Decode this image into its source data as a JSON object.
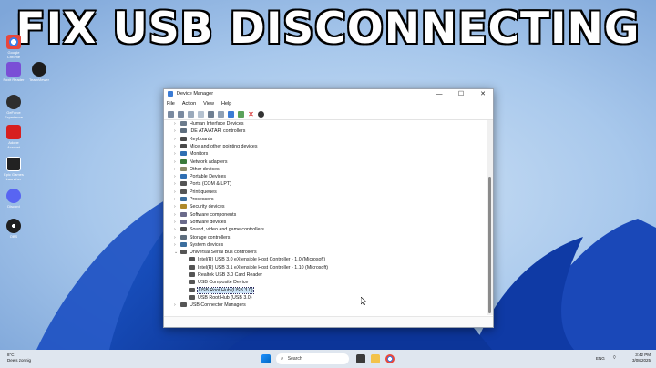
{
  "headline": "FIX USB DISCONNECTING",
  "desktop_icons": [
    {
      "label": "Google Chrome",
      "icon": "chrome-icon",
      "color": "#e8473c"
    },
    {
      "label": "Foxit Reader",
      "icon": "app-icon",
      "color": "#7a4fd6"
    },
    {
      "label": "GeForce Experience",
      "icon": "app-icon",
      "color": "#2e2e2e"
    },
    {
      "label": "Adobe Acrobat",
      "icon": "pdf-icon",
      "color": "#d71f1f"
    },
    {
      "label": "Epic Games Launcher",
      "icon": "epic-icon",
      "color": "#222222"
    },
    {
      "label": "Discord",
      "icon": "discord-icon",
      "color": "#5865f2"
    },
    {
      "label": "OBS",
      "icon": "obs-icon",
      "color": "#1f1f1f"
    },
    {
      "label": "TeamViewer",
      "icon": "chat-icon",
      "color": "#1d1d1d"
    }
  ],
  "window": {
    "title": "Device Manager",
    "controls": {
      "minimize": "—",
      "maximize": "☐",
      "close": "✕"
    },
    "menu": [
      "File",
      "Action",
      "View",
      "Help"
    ]
  },
  "tree": [
    {
      "label": "Human Interface Devices",
      "level": 1,
      "expander": "›",
      "color": "#6b7b8c"
    },
    {
      "label": "IDE ATA/ATAPI controllers",
      "level": 1,
      "expander": "›",
      "color": "#5e6e7e"
    },
    {
      "label": "Keyboards",
      "level": 1,
      "expander": "›",
      "color": "#4a4a4a"
    },
    {
      "label": "Mice and other pointing devices",
      "level": 1,
      "expander": "›",
      "color": "#4a4a4a"
    },
    {
      "label": "Monitors",
      "level": 1,
      "expander": "›",
      "color": "#2f6fb3"
    },
    {
      "label": "Network adapters",
      "level": 1,
      "expander": "›",
      "color": "#3a7a3a"
    },
    {
      "label": "Other devices",
      "level": 1,
      "expander": "›",
      "color": "#8b8b6a"
    },
    {
      "label": "Portable Devices",
      "level": 1,
      "expander": "›",
      "color": "#2f6fb3"
    },
    {
      "label": "Ports (COM & LPT)",
      "level": 1,
      "expander": "›",
      "color": "#555555"
    },
    {
      "label": "Print queues",
      "level": 1,
      "expander": "›",
      "color": "#555555"
    },
    {
      "label": "Processors",
      "level": 1,
      "expander": "›",
      "color": "#3b6e9e"
    },
    {
      "label": "Security devices",
      "level": 1,
      "expander": "›",
      "color": "#b08a2a"
    },
    {
      "label": "Software components",
      "level": 1,
      "expander": "›",
      "color": "#6a6a8a"
    },
    {
      "label": "Software devices",
      "level": 1,
      "expander": "›",
      "color": "#6a6a8a"
    },
    {
      "label": "Sound, video and game controllers",
      "level": 1,
      "expander": "›",
      "color": "#4a4a4a"
    },
    {
      "label": "Storage controllers",
      "level": 1,
      "expander": "›",
      "color": "#5e6e7e"
    },
    {
      "label": "System devices",
      "level": 1,
      "expander": "›",
      "color": "#3b6e9e"
    },
    {
      "label": "Universal Serial Bus controllers",
      "level": 1,
      "expander": "⌄",
      "color": "#555555"
    },
    {
      "label": "Intel(R) USB 3.0 eXtensible Host Controller - 1.0 (Microsoft)",
      "level": 2,
      "expander": "",
      "color": "#555555"
    },
    {
      "label": "Intel(R) USB 3.1 eXtensible Host Controller - 1.10 (Microsoft)",
      "level": 2,
      "expander": "",
      "color": "#555555"
    },
    {
      "label": "Realtek USB 3.0 Card Reader",
      "level": 2,
      "expander": "",
      "color": "#555555"
    },
    {
      "label": "USB Composite Device",
      "level": 2,
      "expander": "",
      "color": "#555555"
    },
    {
      "label": "USB Root Hub (USB 3.0)",
      "level": 2,
      "expander": "",
      "color": "#555555",
      "selected": true
    },
    {
      "label": "USB Root Hub (USB 3.0)",
      "level": 2,
      "expander": "",
      "color": "#555555"
    },
    {
      "label": "USB Connector Managers",
      "level": 1,
      "expander": "›",
      "color": "#555555"
    }
  ],
  "taskbar": {
    "weather_temp": "8°C",
    "weather_desc": "Deels zonnig",
    "search_placeholder": "Search",
    "language": "ENG",
    "time": "3:42 PM",
    "date": "3/08/2025"
  },
  "colors": {
    "accent": "#0067c0",
    "selection": "#cce4f7"
  }
}
